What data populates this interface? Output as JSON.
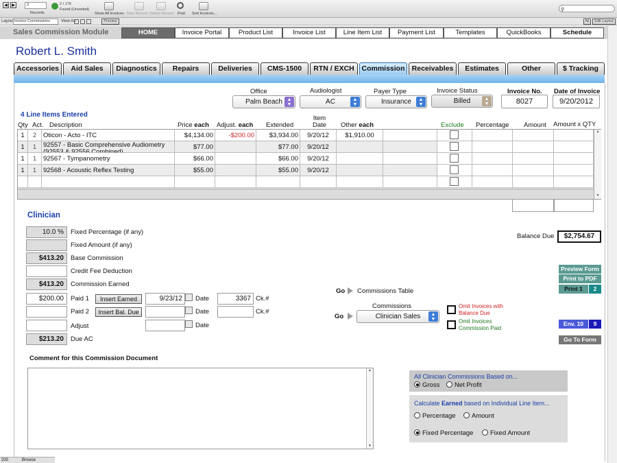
{
  "toolbar": {
    "record_number": "2",
    "records_label": "Records",
    "found_count": "2 / 179",
    "found_label": "Found (Unsorted)",
    "buttons": [
      "Show All Invoices",
      "New Record",
      "Delete Record",
      "Find",
      "Sort Invoices..."
    ]
  },
  "layoutbar": {
    "layout_label": "Layout:",
    "layout_value": "Invoice Commissions",
    "view_as_label": "View As:",
    "preview_label": "Preview",
    "aa_label": "Aā",
    "edit_layout_label": "Edit Layout"
  },
  "header": {
    "module_title": "Sales Commission Module",
    "nav": [
      "HOME",
      "Invoice Portal",
      "Product List",
      "Invoice List",
      "Line Item List",
      "Payment List",
      "Templates",
      "QuickBooks",
      "Schedule"
    ]
  },
  "patient_name": "Robert L. Smith",
  "tabs": [
    "Accessories",
    "Aid Sales",
    "Diagnostics",
    "Repairs",
    "Deliveries",
    "CMS-1500",
    "RTN / EXCH",
    "Commission",
    "Receivables",
    "Estimates",
    "Other",
    "$ Tracking"
  ],
  "invoice": {
    "office_label": "Office",
    "office_value": "Palm Beach",
    "audiologist_label": "Audiologist",
    "audiologist_value": "AC",
    "payer_label": "Payer Type",
    "payer_value": "Insurance",
    "status_label": "Invoice Status",
    "status_value": "Billed",
    "number_label": "Invoice No.",
    "number_value": "8027",
    "date_label": "Date of Invoice",
    "date_value": "9/20/2012"
  },
  "line_items": {
    "count_label": "4 Line Items Entered",
    "headers": {
      "qty": "Qty",
      "act": "Act.",
      "description": "Description",
      "price": "Price",
      "price_each": "each",
      "adjust": "Adjust.",
      "adjust_each": "each",
      "extended": "Extended",
      "item_date": "Item Date",
      "other": "Other",
      "other_each": "each",
      "exclude": "Exclude",
      "percentage": "Percentage",
      "amount": "Amount",
      "amount_qty": "Amount x QTY"
    },
    "rows": [
      {
        "qty": "1",
        "act": "2",
        "description": "Oticon - Acto - ITC",
        "price": "$4,134.00",
        "adjust": "-$200.00",
        "extended": "$3,934.00",
        "date": "9/20/12",
        "other": "$1,910.00"
      },
      {
        "qty": "1",
        "act": "1",
        "description": "92557 - Basic Comprehensive Audiometry (92553 & 92556 Combined)",
        "price": "$77.00",
        "adjust": "",
        "extended": "$77.00",
        "date": "9/20/12",
        "other": ""
      },
      {
        "qty": "1",
        "act": "1",
        "description": "92567 - Tympanometry",
        "price": "$66.00",
        "adjust": "",
        "extended": "$66.00",
        "date": "9/20/12",
        "other": ""
      },
      {
        "qty": "1",
        "act": "1",
        "description": "92568 - Acoustic Reflex Testing",
        "price": "$55.00",
        "adjust": "",
        "extended": "$55.00",
        "date": "9/20/12",
        "other": ""
      }
    ]
  },
  "clinician": {
    "section_title": "Clinician",
    "fixed_pct_value": "10.0 %",
    "fixed_pct_label": "Fixed Percentage (if any)",
    "fixed_amt_label": "Fixed Amount (if any)",
    "base_value": "$413.20",
    "base_label": "Base Commission",
    "credit_label": "Credit Fee Deduction",
    "earned_value": "$413.20",
    "earned_label": "Commission Earned",
    "paid1_value": "$200.00",
    "paid1_label": "Paid 1",
    "insert_earned": "Insert Earned",
    "paid1_date": "9/23/12",
    "date_label": "Date",
    "paid1_ck": "3367",
    "ck_label": "Ck.#",
    "paid2_label": "Paid 2",
    "insert_bal": "Insert Bal. Due",
    "adjust_label": "Adjust",
    "due_value": "$213.20",
    "due_label": "Due AC"
  },
  "balance_label": "Balance Due",
  "balance_value": "$2,754.67",
  "go": {
    "go_label": "Go",
    "commissions_table": "Commissions Table",
    "commissions_label": "Commissions",
    "commissions_value": "Clinician Sales",
    "omit_balance": "Omit Invoices with Balance Due",
    "omit_paid": "Omit Invoices Commission Paid"
  },
  "side_buttons": {
    "preview_form": "Preview Form",
    "print_pdf": "Print to PDF",
    "print1": "Print 1",
    "print1_count": "2",
    "env10": "Env. 10",
    "env10_count": "9",
    "go_to_form": "Go To Form"
  },
  "comment_label": "Comment for this Commission Document",
  "options": {
    "based_on_title": "All Clinician Commissions Based on...",
    "gross": "Gross",
    "net_profit": "Net Profit",
    "calc_prefix": "Calculate ",
    "calc_bold": "Earned",
    "calc_suffix": " based on Individual Line Item...",
    "percentage": "Percentage",
    "amount": "Amount",
    "fixed_percentage": "Fixed Percentage",
    "fixed_amount": "Fixed Amount"
  },
  "statusbar": {
    "zoom": "200",
    "mode": "Browse"
  },
  "colors": {
    "nav_home": "#6c6c6c",
    "tab_active": "#9ccbf0",
    "accent_blue": "#1a3fa6",
    "red": "#cc2222",
    "green": "#1e7a1e"
  }
}
